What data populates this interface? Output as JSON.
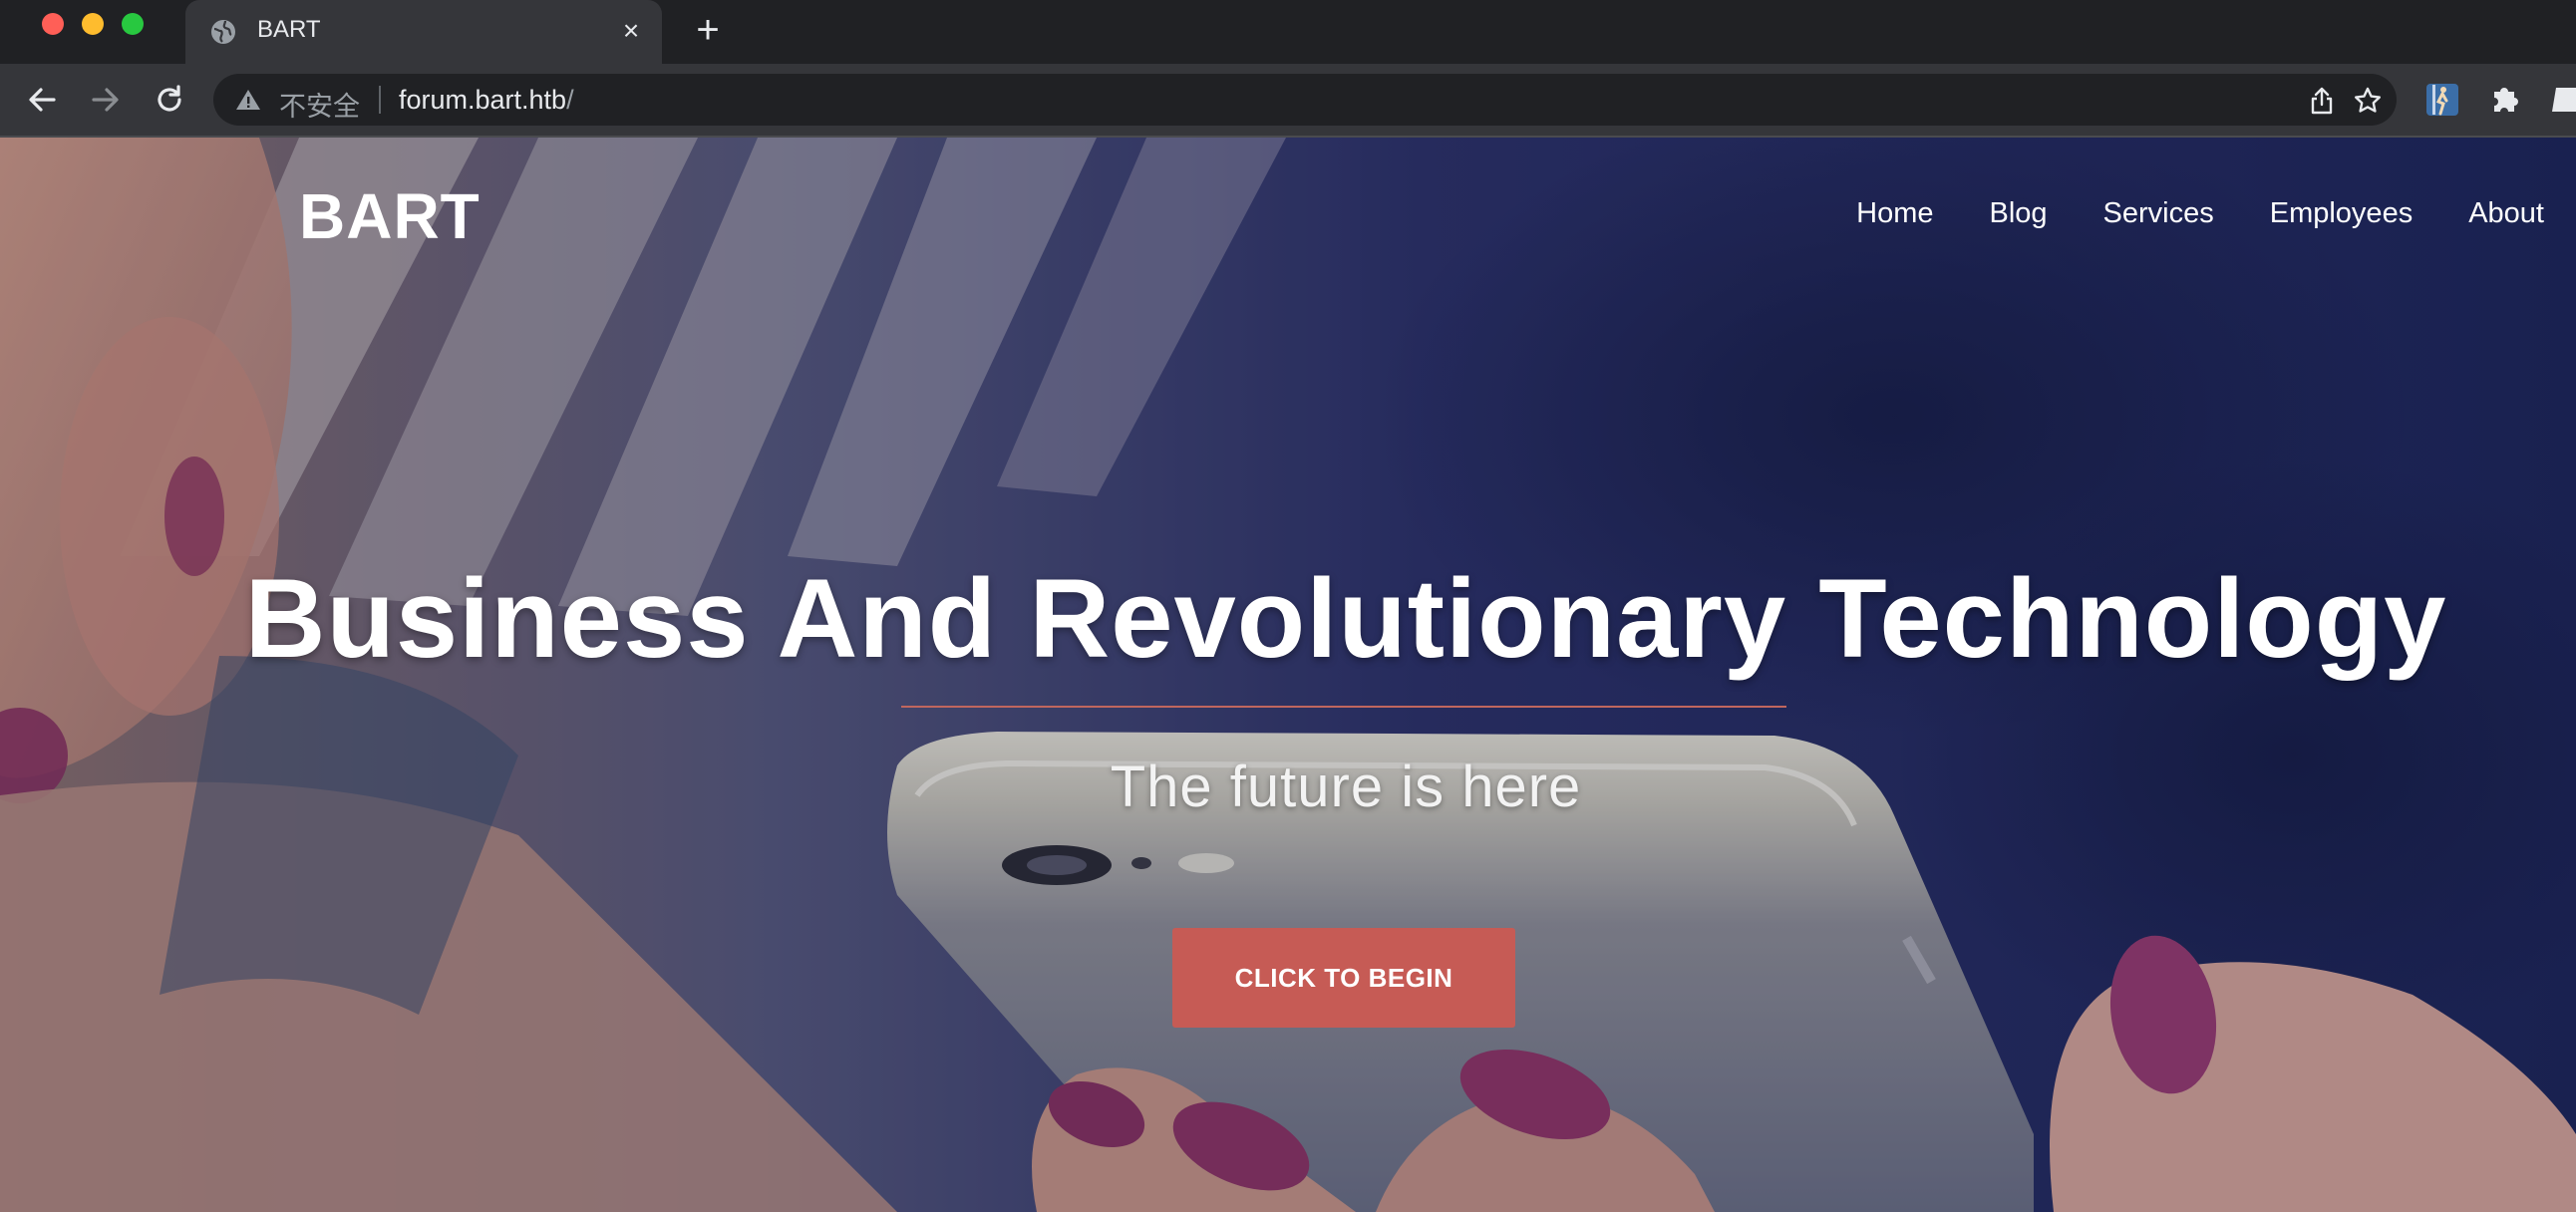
{
  "browser": {
    "tab_title": "BART",
    "tab_close": "×",
    "new_tab": "+",
    "security_label": "不安全",
    "url_host": "forum.bart.htb",
    "url_path": "/"
  },
  "site": {
    "brand": "BART",
    "nav": [
      "Home",
      "Blog",
      "Services",
      "Employees",
      "About"
    ],
    "headline": "Business And Revolutionary Technology",
    "subheadline": "The future is here",
    "cta_label": "CLICK TO BEGIN"
  },
  "colors": {
    "accent": "#c65b55",
    "divider": "#c0665e",
    "text": "#ffffff"
  },
  "icons": [
    "globe-icon",
    "close-icon",
    "plus-icon",
    "back-arrow-icon",
    "forward-arrow-icon",
    "reload-icon",
    "warning-icon",
    "share-icon",
    "star-icon",
    "extension-icon",
    "puzzle-icon"
  ]
}
